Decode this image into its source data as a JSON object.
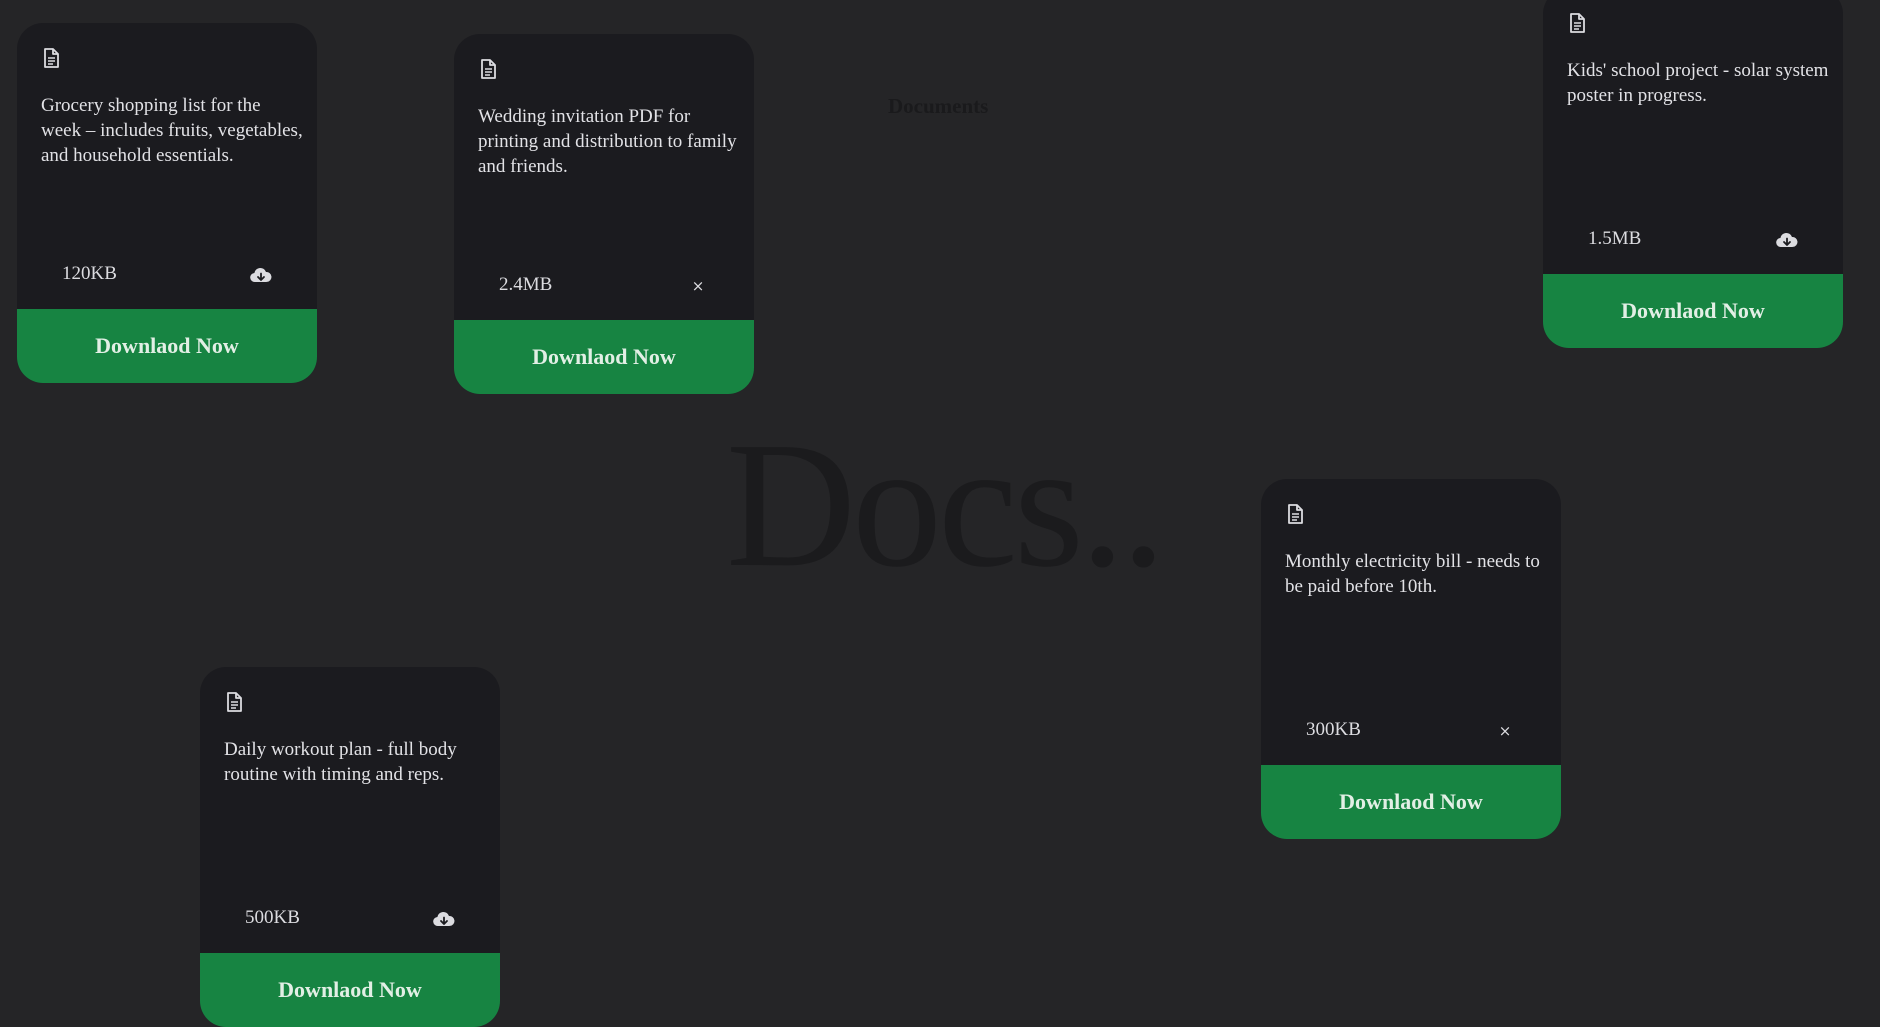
{
  "header": {
    "section_label": "Documents",
    "hero_title": "Docs.."
  },
  "icons": {
    "document": "document-icon",
    "download": "cloud-download-icon",
    "close": "close-icon"
  },
  "colors": {
    "background": "#252527",
    "card": "#1b1b1f",
    "accent": "#178442"
  },
  "cards": [
    {
      "description": "Grocery shopping list for the week – includes fruits, vegetables, and household essentials.",
      "size": "120KB",
      "action": "download",
      "action_glyph": "",
      "button_label": "Downlaod Now"
    },
    {
      "description": "Wedding invitation PDF for printing and distribution to family and friends.",
      "size": "2.4MB",
      "action": "close",
      "action_glyph": "×",
      "button_label": "Downlaod Now"
    },
    {
      "description": "Kids' school project - solar system poster in progress.",
      "size": "1.5MB",
      "action": "download",
      "action_glyph": "",
      "button_label": "Downlaod Now"
    },
    {
      "description": "Monthly electricity bill - needs to be paid before 10th.",
      "size": "300KB",
      "action": "close",
      "action_glyph": "×",
      "button_label": "Downlaod Now"
    },
    {
      "description": "Daily workout plan - full body routine with timing and reps.",
      "size": "500KB",
      "action": "download",
      "action_glyph": "",
      "button_label": "Downlaod Now"
    }
  ]
}
